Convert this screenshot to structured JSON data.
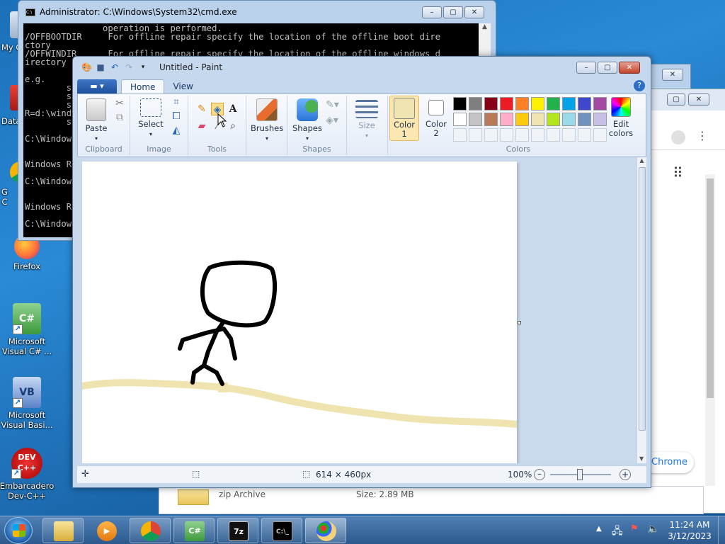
{
  "desktop": {
    "icons": [
      {
        "label": "My C"
      },
      {
        "label": "Data"
      },
      {
        "label": "G\nC"
      },
      {
        "label": "Firefox"
      },
      {
        "label": "Microsoft\nVisual C# ..."
      },
      {
        "label": "Microsoft\nVisual Basi..."
      },
      {
        "label": "Embarcadero\nDev-C++"
      }
    ]
  },
  "cmd": {
    "title": "Administrator: C:\\Windows\\System32\\cmd.exe",
    "lines": [
      "               operation is performed.",
      "/OFFBOOTDIR     For offline repair specify the location of the offline boot dire",
      "ctory",
      "/OFFWINDIR      For offline repair specify the location of the offline windows d",
      "irectory",
      "",
      "e.g.",
      "        s",
      "        s",
      "        s",
      "R=d:\\wind",
      "        s",
      "",
      "C:\\Window",
      "",
      "",
      "Windows R",
      "",
      "C:\\Window",
      "",
      "",
      "Windows R",
      "",
      "C:\\Window"
    ]
  },
  "paint": {
    "title": "Untitled - Paint",
    "tabs": {
      "file": "",
      "home": "Home",
      "view": "View"
    },
    "groups": {
      "clipboard": "Clipboard",
      "image": "Image",
      "tools": "Tools",
      "shapes": "Shapes",
      "colors": "Colors"
    },
    "buttons": {
      "paste": "Paste",
      "select": "Select",
      "brushes": "Brushes",
      "shapes": "Shapes",
      "size": "Size",
      "color1": "Color\n1",
      "color2": "Color\n2",
      "edit_colors": "Edit\ncolors"
    },
    "palette_row1": [
      "#000000",
      "#7f7f7f",
      "#880015",
      "#ed1c24",
      "#ff7f27",
      "#fff200",
      "#22b14c",
      "#00a2e8",
      "#3f48cc",
      "#a349a4"
    ],
    "palette_row2": [
      "#ffffff",
      "#c3c3c3",
      "#b97a57",
      "#ffaec9",
      "#ffc90e",
      "#efe4b0",
      "#b5e61d",
      "#99d9ea",
      "#7092be",
      "#c8bfe7"
    ],
    "color1": "#efe4b0",
    "color2": "#ffffff",
    "status": {
      "image_size": "614 × 460px",
      "zoom": "100%"
    },
    "canvas_width": 614,
    "canvas_height": 460
  },
  "chrome_partial": {
    "label": "Chrome"
  },
  "explorer_partial": {
    "type": "zip Archive",
    "size": "Size: 2.89 MB"
  },
  "taskbar": {
    "time": "11:24 AM",
    "date": "3/12/2023"
  }
}
